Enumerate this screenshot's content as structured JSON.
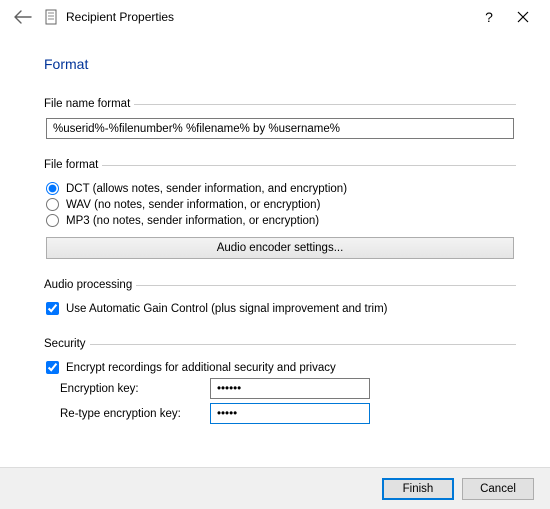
{
  "titlebar": {
    "title": "Recipient Properties"
  },
  "page": {
    "heading": "Format"
  },
  "filename": {
    "legend": "File name format",
    "value": "%userid%-%filenumber% %filename% by %username%"
  },
  "fileformat": {
    "legend": "File format",
    "options": {
      "dct": "DCT (allows notes, sender information, and encryption)",
      "wav": "WAV (no notes, sender information, or encryption)",
      "mp3": "MP3 (no notes, sender information, or encryption)"
    },
    "encoder_button": "Audio encoder settings..."
  },
  "audioproc": {
    "legend": "Audio processing",
    "agc": "Use Automatic Gain Control (plus signal improvement and trim)"
  },
  "security": {
    "legend": "Security",
    "encrypt": "Encrypt recordings for additional security and privacy",
    "key_label": "Encryption key:",
    "retype_label": "Re-type encryption key:",
    "key_value": "••••••",
    "retype_value": "•••••"
  },
  "footer": {
    "finish": "Finish",
    "cancel": "Cancel"
  }
}
